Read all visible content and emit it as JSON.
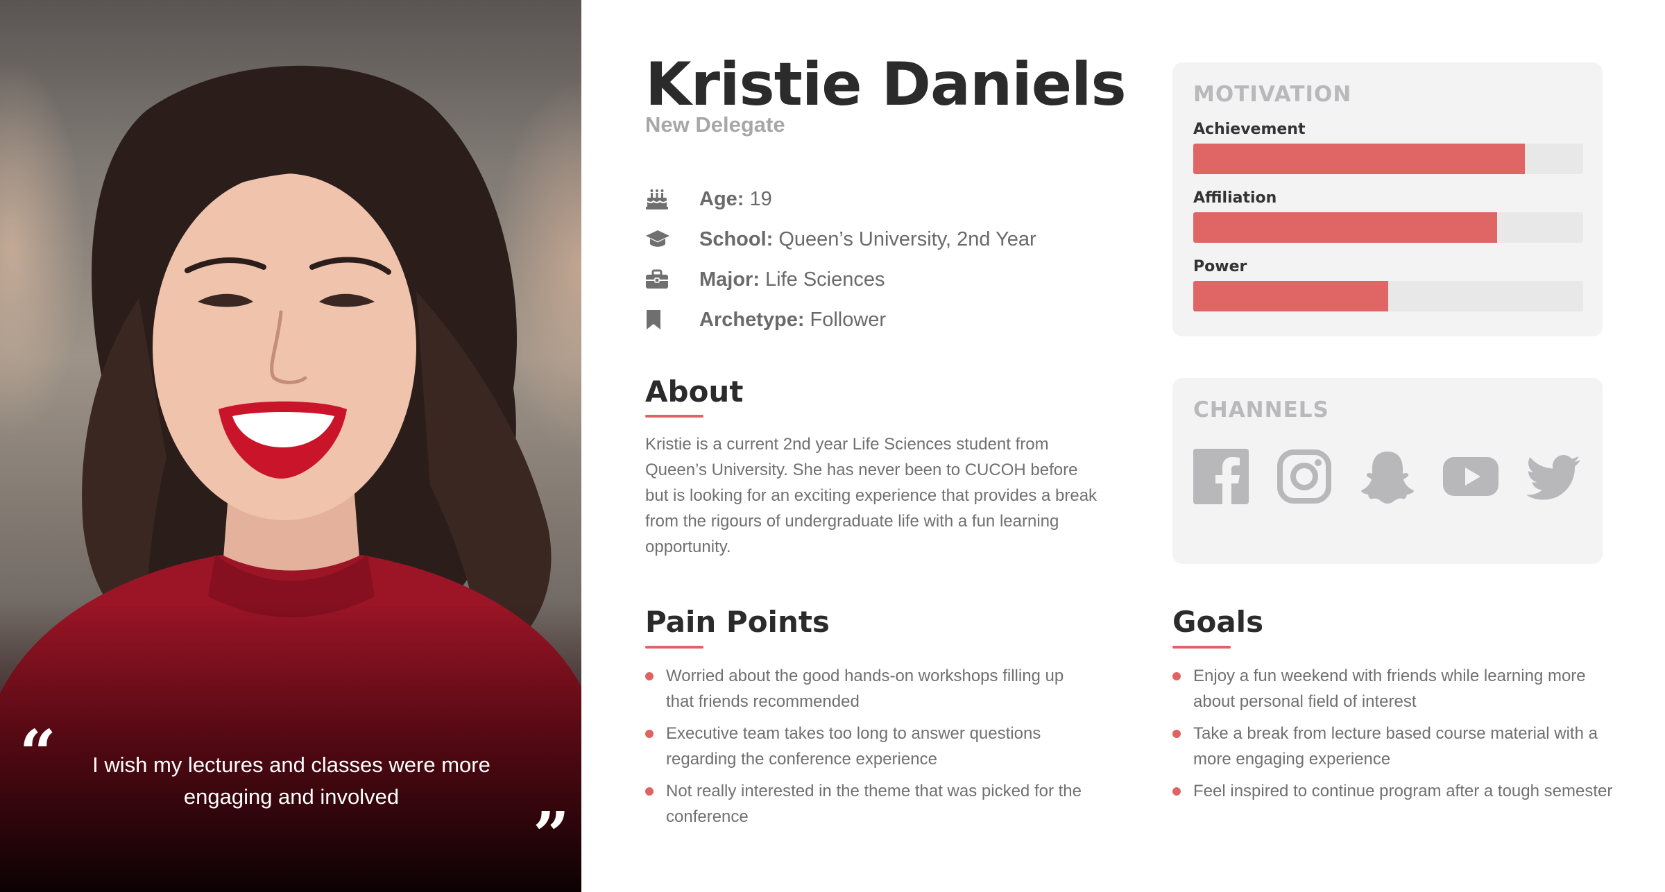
{
  "persona": {
    "name": "Kristie Daniels",
    "role": "New Delegate",
    "quote": "I wish my lectures and classes were more engaging and involved",
    "quote_open": "“",
    "quote_close": "”"
  },
  "facts": [
    {
      "icon": "birthday-cake-icon",
      "label": "Age:",
      "value": "19"
    },
    {
      "icon": "graduation-cap-icon",
      "label": "School:",
      "value": "Queen’s University, 2nd Year"
    },
    {
      "icon": "briefcase-icon",
      "label": "Major:",
      "value": "Life Sciences"
    },
    {
      "icon": "bookmark-icon",
      "label": "Archetype:",
      "value": "Follower"
    }
  ],
  "about": {
    "title": "About",
    "text": "Kristie is a current 2nd year Life Sciences student from Queen’s University. She has never been to CUCOH before but is looking for an exciting experience that provides a break from the rigours of undergraduate life with a fun learning opportunity."
  },
  "pain_points": {
    "title": "Pain Points",
    "items": [
      "Worried about the good hands-on workshops filling up that friends recommended",
      "Executive team takes too long to answer questions regarding the conference experience",
      "Not really interested in the theme that was picked for the conference"
    ]
  },
  "goals": {
    "title": "Goals",
    "items": [
      "Enjoy a fun weekend with friends while learning more about personal field of interest",
      "Take a break from lecture based course material with a more engaging experience",
      "Feel inspired to continue program after a tough semester"
    ]
  },
  "motivation": {
    "title": "MOTIVATION",
    "items": [
      {
        "label": "Achievement",
        "level": 0.85
      },
      {
        "label": "Affiliation",
        "level": 0.78
      },
      {
        "label": "Power",
        "level": 0.5
      }
    ]
  },
  "channels": {
    "title": "CHANNELS",
    "items": [
      "facebook-icon",
      "instagram-icon",
      "snapchat-icon",
      "youtube-icon",
      "twitter-icon"
    ]
  },
  "colors": {
    "accent": "#e06363",
    "bar_fill": "#e06666",
    "card_bg": "#f3f3f4",
    "icon_gray": "#b8b8ba",
    "heading": "#2b2b2b",
    "muted": "#a7a7a7"
  }
}
